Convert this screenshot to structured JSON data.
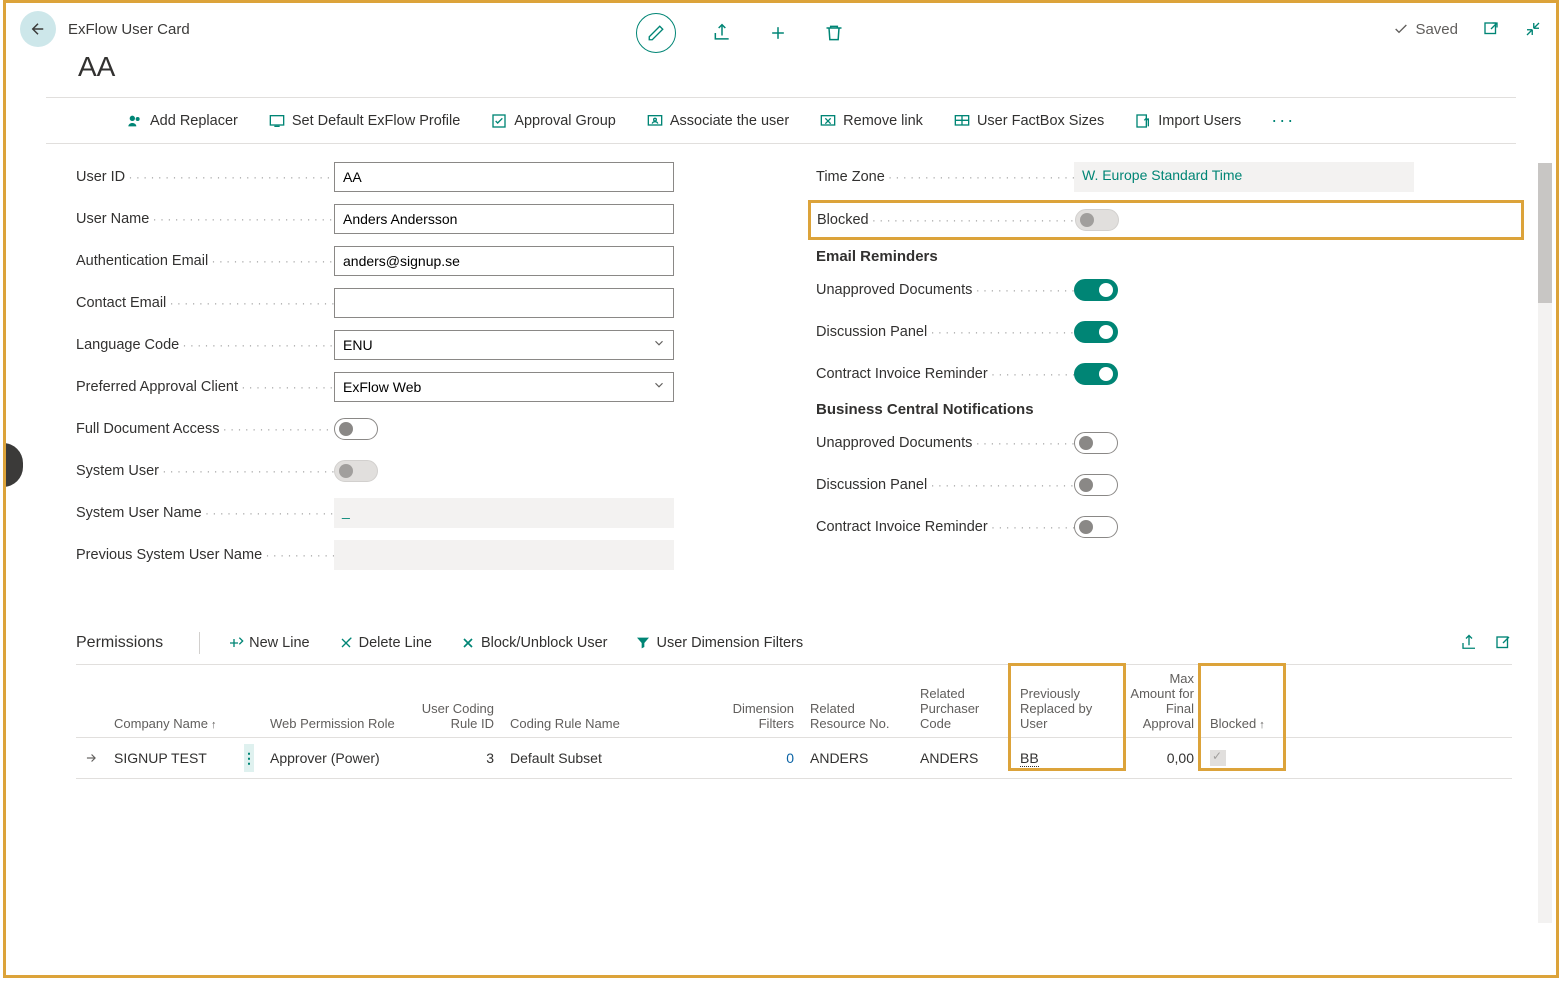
{
  "header": {
    "breadcrumb": "ExFlow User Card",
    "title": "AA",
    "saved_label": "Saved"
  },
  "actions": {
    "add_replacer": "Add Replacer",
    "set_default_profile": "Set Default ExFlow Profile",
    "approval_group": "Approval Group",
    "associate_user": "Associate the user",
    "remove_link": "Remove link",
    "user_factbox_sizes": "User FactBox Sizes",
    "import_users": "Import Users"
  },
  "fields": {
    "user_id": {
      "label": "User ID",
      "value": "AA"
    },
    "user_name": {
      "label": "User Name",
      "value": "Anders Andersson"
    },
    "auth_email": {
      "label": "Authentication Email",
      "value": "anders@signup.se"
    },
    "contact_email": {
      "label": "Contact Email",
      "value": ""
    },
    "language_code": {
      "label": "Language Code",
      "value": "ENU"
    },
    "pref_client": {
      "label": "Preferred Approval Client",
      "value": "ExFlow Web"
    },
    "full_doc_access": {
      "label": "Full Document Access"
    },
    "system_user": {
      "label": "System User"
    },
    "system_user_name": {
      "label": "System User Name",
      "value": "_"
    },
    "prev_system_user_name": {
      "label": "Previous System User Name",
      "value": ""
    },
    "time_zone": {
      "label": "Time Zone",
      "value": "W. Europe Standard Time"
    },
    "blocked": {
      "label": "Blocked"
    },
    "email_reminders_h": "Email Reminders",
    "er_unapproved": {
      "label": "Unapproved Documents"
    },
    "er_discussion": {
      "label": "Discussion Panel"
    },
    "er_contract": {
      "label": "Contract Invoice Reminder"
    },
    "bc_notif_h": "Business Central Notifications",
    "bc_unapproved": {
      "label": "Unapproved Documents"
    },
    "bc_discussion": {
      "label": "Discussion Panel"
    },
    "bc_contract": {
      "label": "Contract Invoice Reminder"
    }
  },
  "permissions": {
    "title": "Permissions",
    "new_line": "New Line",
    "delete_line": "Delete Line",
    "block_unblock": "Block/Unblock User",
    "user_dim_filters": "User Dimension Filters",
    "columns": {
      "company": "Company Name",
      "role": "Web Permission Role",
      "ruleid": "User Coding Rule ID",
      "rulename": "Coding Rule Name",
      "dimf": "Dimension Filters",
      "relres": "Related Resource No.",
      "relpur": "Related Purchaser Code",
      "prevrep": "Previously Replaced by User",
      "maxamt": "Max Amount for Final Approval",
      "blocked": "Blocked"
    },
    "rows": [
      {
        "company": "SIGNUP TEST",
        "role": "Approver (Power)",
        "ruleid": "3",
        "rulename": "Default Subset",
        "dimf": "0",
        "relres": "ANDERS",
        "relpur": "ANDERS",
        "prevrep": "BB",
        "maxamt": "0,00",
        "blocked": true
      }
    ]
  }
}
